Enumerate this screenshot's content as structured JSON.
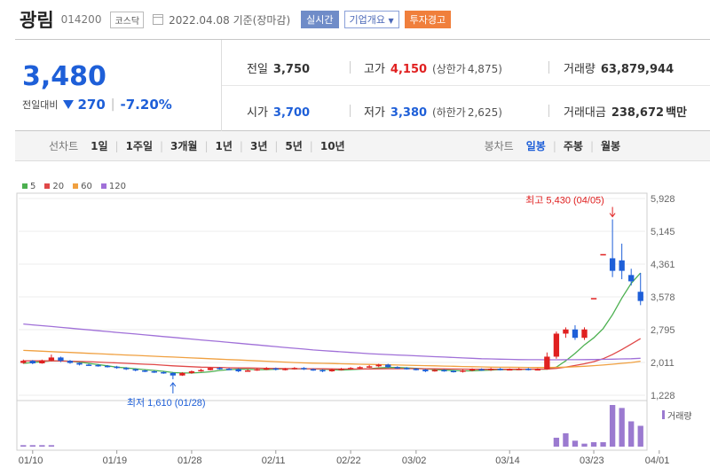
{
  "header": {
    "name": "광림",
    "code": "014200",
    "market": "코스닥",
    "date": "2022.04.08 기준(장마감)",
    "btn_realtime": "실시간",
    "btn_company": "기업개요",
    "btn_warning": "투자경고"
  },
  "price": {
    "current": "3,480",
    "change_label": "전일대비",
    "change": "270",
    "change_pct": "-7.20%"
  },
  "stats": {
    "prev_label": "전일",
    "prev": "3,750",
    "high_label": "고가",
    "high": "4,150",
    "upper_label": "(상한가",
    "upper": "4,875)",
    "volume_label": "거래량",
    "volume": "63,879,944",
    "open_label": "시가",
    "open": "3,700",
    "low_label": "저가",
    "low": "3,380",
    "lower_label": "(하한가",
    "lower": "2,625)",
    "amount_label": "거래대금",
    "amount": "238,672",
    "amount_unit": "백만"
  },
  "tabs": {
    "line_label": "선차트",
    "periods": [
      "1일",
      "1주일",
      "3개월",
      "1년",
      "3년",
      "5년",
      "10년"
    ],
    "candle_label": "봉차트",
    "candles": [
      "일봉",
      "주봉",
      "월봉"
    ],
    "active_candle": "일봉"
  },
  "chart_data": {
    "type": "candlestick",
    "legend": [
      {
        "name": "5",
        "color": "#4cb050"
      },
      {
        "name": "20",
        "color": "#e04848"
      },
      {
        "name": "60",
        "color": "#f0a040"
      },
      {
        "name": "120",
        "color": "#a070d8"
      }
    ],
    "yticks": [
      "5,928",
      "5,145",
      "4,361",
      "3,578",
      "2,795",
      "2,011",
      "1,228"
    ],
    "ylim": [
      1228,
      5928
    ],
    "xticks": [
      "01/10",
      "01/19",
      "01/28",
      "02/11",
      "02/22",
      "03/02",
      "03/14",
      "03/23",
      "04/01"
    ],
    "high_annotation": "최고 5,430 (04/05)",
    "low_annotation": "최저 1,610 (01/28)",
    "volume_label": "거래량",
    "candles": [
      {
        "o": 2000,
        "c": 2050,
        "h": 2080,
        "l": 1980
      },
      {
        "o": 2050,
        "c": 1990,
        "h": 2070,
        "l": 1970
      },
      {
        "o": 1990,
        "c": 2060,
        "h": 2080,
        "l": 1980
      },
      {
        "o": 2060,
        "c": 2130,
        "h": 2200,
        "l": 2040
      },
      {
        "o": 2130,
        "c": 2050,
        "h": 2150,
        "l": 2020
      },
      {
        "o": 2050,
        "c": 2000,
        "h": 2070,
        "l": 1980
      },
      {
        "o": 2000,
        "c": 1960,
        "h": 2010,
        "l": 1940
      },
      {
        "o": 1960,
        "c": 1950,
        "h": 1980,
        "l": 1930
      },
      {
        "o": 1950,
        "c": 1930,
        "h": 1970,
        "l": 1910
      },
      {
        "o": 1930,
        "c": 1910,
        "h": 1950,
        "l": 1890
      },
      {
        "o": 1910,
        "c": 1880,
        "h": 1930,
        "l": 1860
      },
      {
        "o": 1880,
        "c": 1850,
        "h": 1900,
        "l": 1830
      },
      {
        "o": 1850,
        "c": 1820,
        "h": 1870,
        "l": 1800
      },
      {
        "o": 1820,
        "c": 1800,
        "h": 1840,
        "l": 1780
      },
      {
        "o": 1800,
        "c": 1780,
        "h": 1820,
        "l": 1760
      },
      {
        "o": 1780,
        "c": 1760,
        "h": 1800,
        "l": 1740
      },
      {
        "o": 1760,
        "c": 1700,
        "h": 1780,
        "l": 1610
      },
      {
        "o": 1700,
        "c": 1760,
        "h": 1780,
        "l": 1690
      },
      {
        "o": 1760,
        "c": 1800,
        "h": 1820,
        "l": 1740
      },
      {
        "o": 1800,
        "c": 1830,
        "h": 1860,
        "l": 1790
      },
      {
        "o": 1830,
        "c": 1880,
        "h": 1900,
        "l": 1820
      },
      {
        "o": 1880,
        "c": 1860,
        "h": 1900,
        "l": 1840
      },
      {
        "o": 1860,
        "c": 1850,
        "h": 1880,
        "l": 1830
      },
      {
        "o": 1850,
        "c": 1800,
        "h": 1870,
        "l": 1780
      },
      {
        "o": 1800,
        "c": 1820,
        "h": 1850,
        "l": 1790
      },
      {
        "o": 1820,
        "c": 1850,
        "h": 1870,
        "l": 1810
      },
      {
        "o": 1850,
        "c": 1870,
        "h": 1900,
        "l": 1830
      },
      {
        "o": 1870,
        "c": 1840,
        "h": 1890,
        "l": 1820
      },
      {
        "o": 1840,
        "c": 1860,
        "h": 1880,
        "l": 1820
      },
      {
        "o": 1860,
        "c": 1880,
        "h": 1900,
        "l": 1840
      },
      {
        "o": 1880,
        "c": 1850,
        "h": 1900,
        "l": 1830
      },
      {
        "o": 1850,
        "c": 1830,
        "h": 1870,
        "l": 1810
      },
      {
        "o": 1830,
        "c": 1800,
        "h": 1850,
        "l": 1780
      },
      {
        "o": 1800,
        "c": 1840,
        "h": 1860,
        "l": 1790
      },
      {
        "o": 1840,
        "c": 1860,
        "h": 1880,
        "l": 1820
      },
      {
        "o": 1860,
        "c": 1880,
        "h": 1900,
        "l": 1840
      },
      {
        "o": 1880,
        "c": 1900,
        "h": 1920,
        "l": 1860
      },
      {
        "o": 1900,
        "c": 1920,
        "h": 1950,
        "l": 1880
      },
      {
        "o": 1920,
        "c": 1960,
        "h": 1980,
        "l": 1900
      },
      {
        "o": 1960,
        "c": 1900,
        "h": 1980,
        "l": 1880
      },
      {
        "o": 1900,
        "c": 1880,
        "h": 1920,
        "l": 1860
      },
      {
        "o": 1880,
        "c": 1860,
        "h": 1900,
        "l": 1840
      },
      {
        "o": 1860,
        "c": 1840,
        "h": 1880,
        "l": 1820
      },
      {
        "o": 1840,
        "c": 1800,
        "h": 1860,
        "l": 1780
      },
      {
        "o": 1800,
        "c": 1830,
        "h": 1850,
        "l": 1790
      },
      {
        "o": 1830,
        "c": 1810,
        "h": 1850,
        "l": 1790
      },
      {
        "o": 1810,
        "c": 1790,
        "h": 1830,
        "l": 1770
      },
      {
        "o": 1790,
        "c": 1820,
        "h": 1840,
        "l": 1770
      },
      {
        "o": 1820,
        "c": 1850,
        "h": 1870,
        "l": 1800
      },
      {
        "o": 1850,
        "c": 1830,
        "h": 1870,
        "l": 1810
      },
      {
        "o": 1830,
        "c": 1860,
        "h": 1880,
        "l": 1810
      },
      {
        "o": 1860,
        "c": 1840,
        "h": 1880,
        "l": 1820
      },
      {
        "o": 1840,
        "c": 1850,
        "h": 1870,
        "l": 1820
      },
      {
        "o": 1850,
        "c": 1860,
        "h": 1880,
        "l": 1830
      },
      {
        "o": 1860,
        "c": 1840,
        "h": 1880,
        "l": 1820
      },
      {
        "o": 1840,
        "c": 1850,
        "h": 1870,
        "l": 1820
      },
      {
        "o": 1850,
        "c": 2150,
        "h": 2250,
        "l": 1840
      },
      {
        "o": 2150,
        "c": 2700,
        "h": 2750,
        "l": 2100
      },
      {
        "o": 2700,
        "c": 2800,
        "h": 2850,
        "l": 2600
      },
      {
        "o": 2800,
        "c": 2600,
        "h": 2900,
        "l": 2550
      },
      {
        "o": 2600,
        "c": 2800,
        "h": 2850,
        "l": 2550
      },
      {
        "o": 3550,
        "c": 3550,
        "h": 3550,
        "l": 3550
      },
      {
        "o": 4600,
        "c": 4600,
        "h": 4600,
        "l": 4600
      },
      {
        "o": 4500,
        "c": 4200,
        "h": 5430,
        "l": 4050
      },
      {
        "o": 4450,
        "c": 4200,
        "h": 4850,
        "l": 4000
      },
      {
        "o": 4100,
        "c": 3950,
        "h": 4250,
        "l": 3850
      },
      {
        "o": 3700,
        "c": 3480,
        "h": 4150,
        "l": 3380
      }
    ],
    "ma": {
      "ma5": [
        1990,
        2010,
        2030,
        2050,
        2050,
        2040,
        2020,
        1990,
        1960,
        1930,
        1900,
        1880,
        1860,
        1840,
        1820,
        1800,
        1770,
        1760,
        1760,
        1770,
        1790,
        1820,
        1840,
        1850,
        1850,
        1840,
        1840,
        1850,
        1860,
        1860,
        1860,
        1860,
        1850,
        1840,
        1830,
        1840,
        1850,
        1860,
        1880,
        1890,
        1890,
        1880,
        1870,
        1860,
        1840,
        1830,
        1820,
        1810,
        1810,
        1820,
        1830,
        1840,
        1840,
        1840,
        1850,
        1850,
        1850,
        1900,
        2050,
        2230,
        2430,
        2600,
        2820,
        3150,
        3550,
        3900,
        4150
      ],
      "ma20": [
        2050,
        2050,
        2050,
        2050,
        2045,
        2040,
        2035,
        2030,
        2020,
        2010,
        2000,
        1990,
        1980,
        1970,
        1960,
        1945,
        1930,
        1920,
        1910,
        1900,
        1895,
        1890,
        1885,
        1880,
        1880,
        1875,
        1870,
        1868,
        1866,
        1864,
        1862,
        1860,
        1858,
        1856,
        1855,
        1855,
        1855,
        1856,
        1858,
        1860,
        1862,
        1864,
        1864,
        1862,
        1860,
        1857,
        1854,
        1852,
        1850,
        1848,
        1848,
        1848,
        1849,
        1850,
        1851,
        1852,
        1853,
        1870,
        1900,
        1940,
        1980,
        2030,
        2100,
        2200,
        2320,
        2450,
        2580
      ],
      "ma60": [
        2300,
        2290,
        2280,
        2270,
        2260,
        2250,
        2240,
        2230,
        2220,
        2210,
        2200,
        2190,
        2180,
        2170,
        2160,
        2150,
        2140,
        2130,
        2120,
        2110,
        2100,
        2090,
        2080,
        2070,
        2060,
        2050,
        2040,
        2030,
        2020,
        2010,
        2000,
        1995,
        1990,
        1985,
        1980,
        1975,
        1970,
        1965,
        1960,
        1955,
        1950,
        1945,
        1940,
        1935,
        1930,
        1925,
        1920,
        1915,
        1910,
        1905,
        1900,
        1898,
        1896,
        1894,
        1892,
        1890,
        1890,
        1895,
        1900,
        1910,
        1920,
        1935,
        1950,
        1970,
        1990,
        2010,
        2040
      ],
      "ma120": [
        2930,
        2910,
        2890,
        2870,
        2850,
        2830,
        2810,
        2790,
        2770,
        2750,
        2730,
        2710,
        2690,
        2670,
        2650,
        2630,
        2610,
        2590,
        2570,
        2550,
        2530,
        2510,
        2490,
        2470,
        2450,
        2430,
        2410,
        2390,
        2370,
        2350,
        2330,
        2310,
        2295,
        2280,
        2265,
        2250,
        2235,
        2220,
        2210,
        2200,
        2190,
        2180,
        2170,
        2160,
        2150,
        2140,
        2130,
        2120,
        2110,
        2100,
        2095,
        2090,
        2085,
        2080,
        2078,
        2076,
        2074,
        2074,
        2076,
        2078,
        2080,
        2082,
        2085,
        2090,
        2095,
        2100,
        2110
      ]
    },
    "volume": [
      1,
      1,
      1,
      1,
      0,
      0,
      0,
      0,
      0,
      0,
      0,
      0,
      0,
      0,
      0,
      0,
      0,
      0,
      0,
      0,
      0,
      0,
      0,
      0,
      0,
      0,
      0,
      0,
      0,
      0,
      0,
      0,
      0,
      0,
      0,
      0,
      0,
      0,
      0,
      0,
      0,
      0,
      0,
      0,
      0,
      0,
      0,
      0,
      0,
      0,
      0,
      0,
      0,
      0,
      0,
      0,
      0,
      6,
      9,
      4,
      2,
      3,
      3,
      28,
      26,
      17,
      14
    ]
  }
}
